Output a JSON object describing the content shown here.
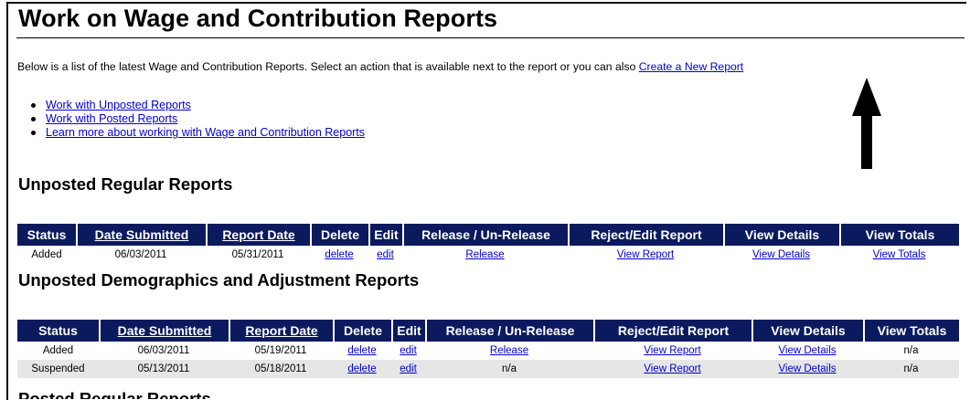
{
  "page": {
    "title": "Work on Wage and Contribution Reports",
    "intro_text": "Below is a list of the latest Wage and Contribution Reports. Select an action that is available next to the report or you can also ",
    "create_link": "Create a New Report"
  },
  "links": [
    {
      "label": "Work with Unposted Reports"
    },
    {
      "label": "Work with Posted Reports"
    },
    {
      "label": "Learn more about working with Wage and Contribution Reports"
    }
  ],
  "unposted_regular": {
    "title": "Unposted Regular Reports",
    "headers": [
      "Status",
      "Date Submitted",
      "Report Date",
      "Delete",
      "Edit",
      "Release / Un-Release",
      "Reject/Edit Report",
      "View Details",
      "View Totals"
    ],
    "rows": [
      {
        "status": "Added",
        "date_submitted": "06/03/2011",
        "report_date": "05/31/2011",
        "delete": "delete",
        "edit": "edit",
        "release": "Release",
        "reject": "View Report",
        "details": "View Details",
        "totals": "View Totals"
      }
    ]
  },
  "unposted_demographics": {
    "title": "Unposted Demographics and Adjustment Reports",
    "headers": [
      "Status",
      "Date Submitted",
      "Report Date",
      "Delete",
      "Edit",
      "Release / Un-Release",
      "Reject/Edit Report",
      "View Details",
      "View Totals"
    ],
    "rows": [
      {
        "status": "Added",
        "date_submitted": "06/03/2011",
        "report_date": "05/19/2011",
        "delete": "delete",
        "edit": "edit",
        "release": "Release",
        "reject": "View Report",
        "details": "View Details",
        "totals": "n/a"
      },
      {
        "status": "Suspended",
        "date_submitted": "05/13/2011",
        "report_date": "05/18/2011",
        "delete": "delete",
        "edit": "edit",
        "release": "n/a",
        "reject": "View Report",
        "details": "View Details",
        "totals": "n/a"
      }
    ]
  },
  "posted_regular": {
    "title": "Posted Regular Reports"
  },
  "colors": {
    "header_bg": "#0b1a5e",
    "link": "#0000cc",
    "alt_row": "#e6e6e6"
  },
  "icons": {
    "annotation_arrow": "up-arrow-icon",
    "bullet": "bullet-icon"
  }
}
